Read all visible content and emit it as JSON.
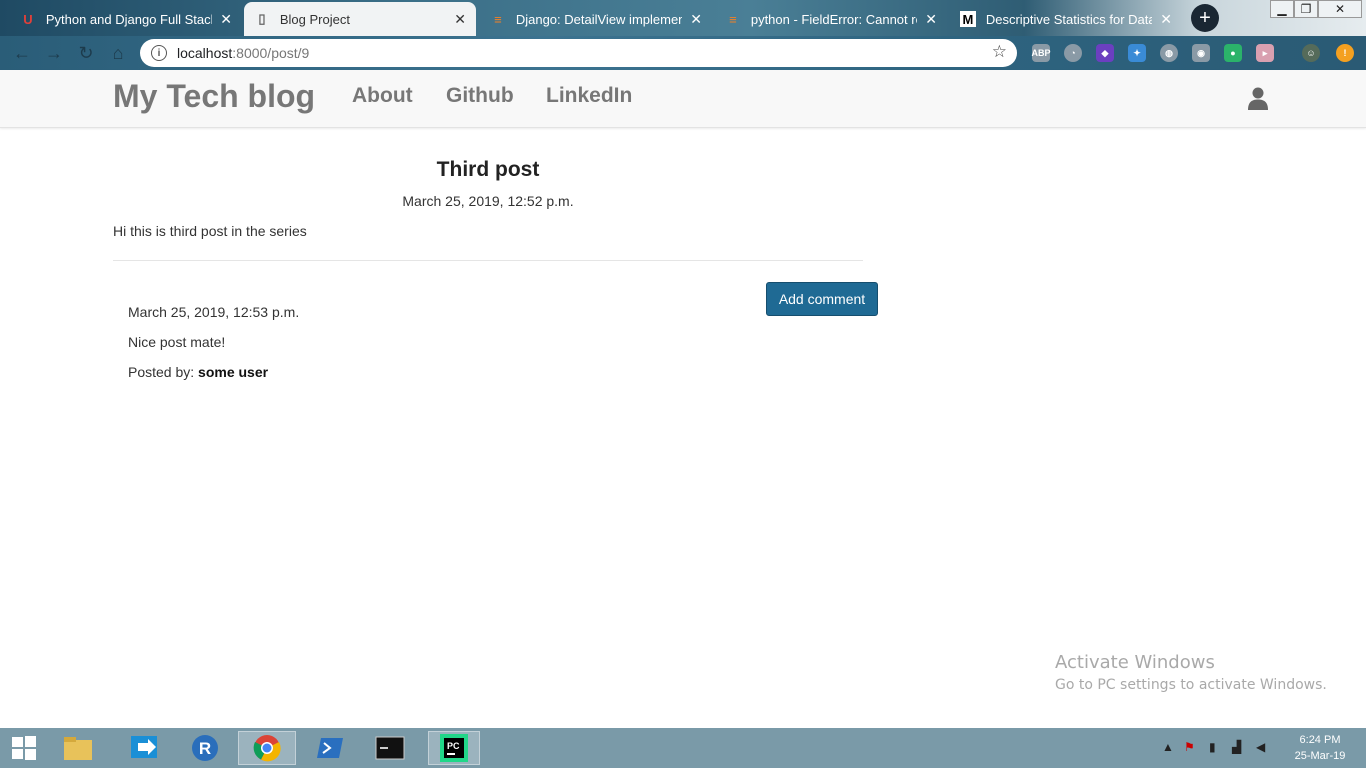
{
  "browser": {
    "tabs": [
      {
        "title": "Python and Django Full Stack W",
        "favicon": "U"
      },
      {
        "title": "Blog Project",
        "favicon": "doc"
      },
      {
        "title": "Django: DetailView implementin",
        "favicon": "stack"
      },
      {
        "title": "python - FieldError: Cannot reso",
        "favicon": "stack"
      },
      {
        "title": "Descriptive Statistics for Data Sc",
        "favicon": "M"
      }
    ],
    "url_host": "localhost",
    "url_rest": ":8000/post/9"
  },
  "site": {
    "brand": "My Tech blog",
    "nav": {
      "about": "About",
      "github": "Github",
      "linkedin": "LinkedIn"
    }
  },
  "post": {
    "title": "Third post",
    "date": "March 25, 2019, 12:52 p.m.",
    "body": "Hi this is third post in the series",
    "add_comment_label": "Add comment"
  },
  "comment": {
    "date": "March 25, 2019, 12:53 p.m.",
    "text": "Nice post mate!",
    "posted_by_label": "Posted by:",
    "author": "some user"
  },
  "watermark": {
    "line1": "Activate Windows",
    "line2": "Go to PC settings to activate Windows."
  },
  "taskbar": {
    "time": "6:24 PM",
    "date": "25-Mar-19"
  }
}
